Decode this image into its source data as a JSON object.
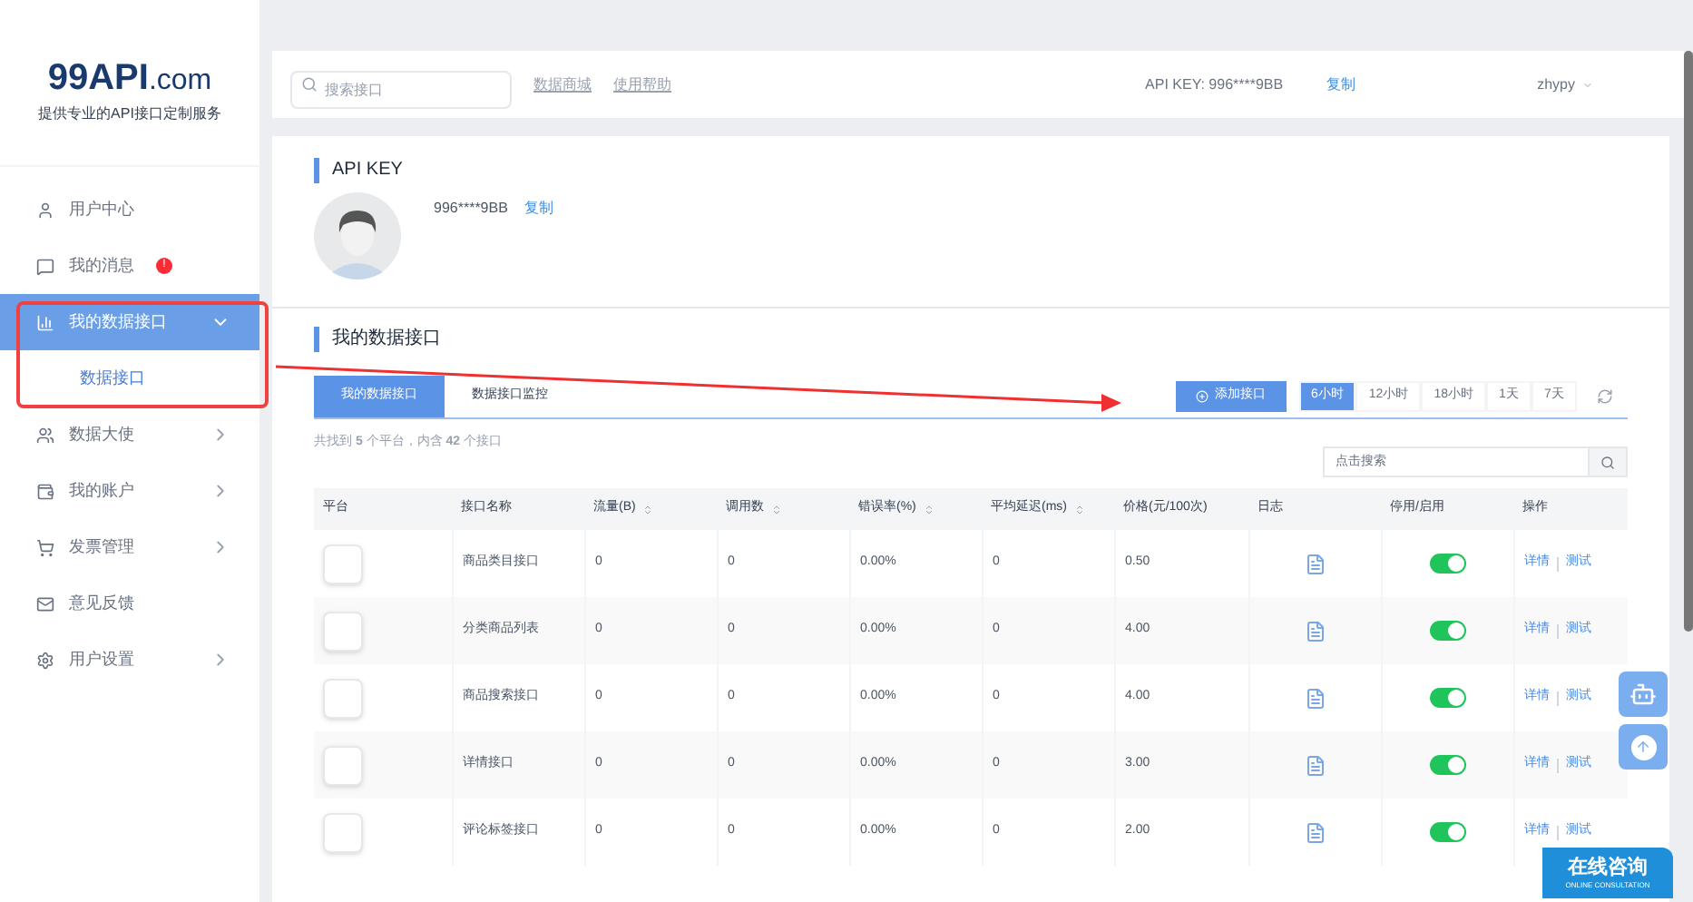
{
  "sidebar": {
    "logo": {
      "main": "99API",
      "suffix": ".com",
      "tagline": "提供专业的API接口定制服务"
    },
    "items": [
      {
        "label": "用户中心",
        "selected": false
      },
      {
        "label": "我的消息",
        "selected": false,
        "badge": "!"
      },
      {
        "label": "我的数据接口",
        "selected": true,
        "expanded": true,
        "children": [
          {
            "label": "数据接口",
            "selected": true
          }
        ]
      },
      {
        "label": "数据大使",
        "selected": false,
        "expanded": false
      },
      {
        "label": "我的账户",
        "selected": false,
        "expanded": false
      },
      {
        "label": "发票管理",
        "selected": false,
        "expanded": false
      },
      {
        "label": "意见反馈",
        "selected": false
      },
      {
        "label": "用户设置",
        "selected": false,
        "expanded": false
      }
    ]
  },
  "header": {
    "search": {
      "placeholder": "搜索接口"
    },
    "links": [
      "数据商城",
      "使用帮助"
    ],
    "api_key_label": "API KEY:",
    "api_key": "996****9BB",
    "copy": "复制",
    "user": "zhypy"
  },
  "api_key_section": {
    "title": "API KEY",
    "key": "996****9BB",
    "copy": "复制"
  },
  "interfaces": {
    "title": "我的数据接口",
    "tabs": [
      {
        "label": "我的数据接口",
        "selected": true
      },
      {
        "label": "数据接口监控",
        "selected": false
      }
    ],
    "add_button": "添加接口",
    "ranges": [
      {
        "label": "6小时",
        "selected": true
      },
      {
        "label": "12小时",
        "selected": false
      },
      {
        "label": "18小时",
        "selected": false
      },
      {
        "label": "1天",
        "selected": false
      },
      {
        "label": "7天",
        "selected": false
      }
    ],
    "summary": "共找到 **5** 个平台，内含 **42** 个接口",
    "search": {
      "placeholder": "点击搜索"
    },
    "columns": [
      {
        "label": "平台",
        "sortable": false
      },
      {
        "label": "接口名称",
        "sortable": false
      },
      {
        "label": "流量(B)",
        "sortable": true
      },
      {
        "label": "调用数",
        "sortable": true
      },
      {
        "label": "错误率(%)",
        "sortable": true
      },
      {
        "label": "平均延迟(ms)",
        "sortable": true
      },
      {
        "label": "价格(元/100次)",
        "sortable": false
      },
      {
        "label": "日志",
        "sortable": false
      },
      {
        "label": "停用/启用",
        "sortable": false
      },
      {
        "label": "操作",
        "sortable": false
      }
    ],
    "rows": [
      {
        "name": "商品类目接口",
        "traffic": "0",
        "calls": "0",
        "error_rate": "0.00%",
        "latency": "0",
        "price": "0.50",
        "on": true,
        "actions": [
          "详情",
          "测试"
        ]
      },
      {
        "name": "分类商品列表",
        "traffic": "0",
        "calls": "0",
        "error_rate": "0.00%",
        "latency": "0",
        "price": "4.00",
        "on": true,
        "actions": [
          "详情",
          "测试"
        ]
      },
      {
        "name": "商品搜索接口",
        "traffic": "0",
        "calls": "0",
        "error_rate": "0.00%",
        "latency": "0",
        "price": "4.00",
        "on": true,
        "actions": [
          "详情",
          "测试"
        ]
      },
      {
        "name": "详情接口",
        "traffic": "0",
        "calls": "0",
        "error_rate": "0.00%",
        "latency": "0",
        "price": "3.00",
        "on": true,
        "actions": [
          "详情",
          "测试"
        ]
      },
      {
        "name": "评论标签接口",
        "traffic": "0",
        "calls": "0",
        "error_rate": "0.00%",
        "latency": "0",
        "price": "2.00",
        "on": true,
        "actions": [
          "详情",
          "测试"
        ]
      }
    ]
  },
  "online_consult": {
    "title": "在线咨询",
    "subtitle": "ONLINE CONSULTATION"
  },
  "annotations": {
    "box": true,
    "arrow": true
  }
}
